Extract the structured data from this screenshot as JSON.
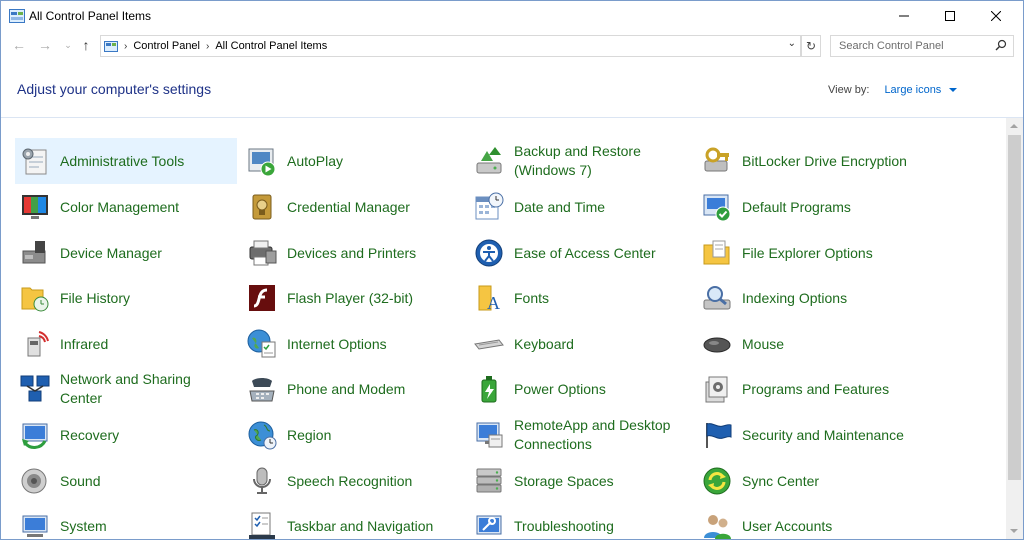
{
  "window": {
    "title": "All Control Panel Items",
    "minimize_icon": "minimize-icon",
    "maximize_icon": "maximize-icon",
    "close_icon": "close-icon"
  },
  "address": {
    "crumbs": [
      "Control Panel",
      "All Control Panel Items"
    ],
    "search_placeholder": "Search Control Panel"
  },
  "header": {
    "heading": "Adjust your computer's settings",
    "view_by_label": "View by:",
    "view_by_value": "Large icons"
  },
  "items": [
    {
      "label": "Administrative Tools",
      "icon": "administrative-tools-icon"
    },
    {
      "label": "AutoPlay",
      "icon": "autoplay-icon"
    },
    {
      "label": "Backup and Restore (Windows 7)",
      "icon": "backup-restore-icon"
    },
    {
      "label": "BitLocker Drive Encryption",
      "icon": "bitlocker-icon"
    },
    {
      "label": "Color Management",
      "icon": "color-management-icon"
    },
    {
      "label": "Credential Manager",
      "icon": "credential-manager-icon"
    },
    {
      "label": "Date and Time",
      "icon": "date-time-icon"
    },
    {
      "label": "Default Programs",
      "icon": "default-programs-icon"
    },
    {
      "label": "Device Manager",
      "icon": "device-manager-icon"
    },
    {
      "label": "Devices and Printers",
      "icon": "devices-printers-icon"
    },
    {
      "label": "Ease of Access Center",
      "icon": "ease-of-access-icon"
    },
    {
      "label": "File Explorer Options",
      "icon": "file-explorer-options-icon"
    },
    {
      "label": "File History",
      "icon": "file-history-icon"
    },
    {
      "label": "Flash Player (32-bit)",
      "icon": "flash-player-icon"
    },
    {
      "label": "Fonts",
      "icon": "fonts-icon"
    },
    {
      "label": "Indexing Options",
      "icon": "indexing-options-icon"
    },
    {
      "label": "Infrared",
      "icon": "infrared-icon"
    },
    {
      "label": "Internet Options",
      "icon": "internet-options-icon"
    },
    {
      "label": "Keyboard",
      "icon": "keyboard-icon"
    },
    {
      "label": "Mouse",
      "icon": "mouse-icon"
    },
    {
      "label": "Network and Sharing Center",
      "icon": "network-sharing-icon"
    },
    {
      "label": "Phone and Modem",
      "icon": "phone-modem-icon"
    },
    {
      "label": "Power Options",
      "icon": "power-options-icon"
    },
    {
      "label": "Programs and Features",
      "icon": "programs-features-icon"
    },
    {
      "label": "Recovery",
      "icon": "recovery-icon"
    },
    {
      "label": "Region",
      "icon": "region-icon"
    },
    {
      "label": "RemoteApp and Desktop Connections",
      "icon": "remoteapp-icon"
    },
    {
      "label": "Security and Maintenance",
      "icon": "security-maintenance-icon"
    },
    {
      "label": "Sound",
      "icon": "sound-icon"
    },
    {
      "label": "Speech Recognition",
      "icon": "speech-recognition-icon"
    },
    {
      "label": "Storage Spaces",
      "icon": "storage-spaces-icon"
    },
    {
      "label": "Sync Center",
      "icon": "sync-center-icon"
    },
    {
      "label": "System",
      "icon": "system-icon"
    },
    {
      "label": "Taskbar and Navigation",
      "icon": "taskbar-navigation-icon"
    },
    {
      "label": "Troubleshooting",
      "icon": "troubleshooting-icon"
    },
    {
      "label": "User Accounts",
      "icon": "user-accounts-icon"
    }
  ],
  "colors": {
    "link_green": "#1e6c1e",
    "heading_blue": "#1e3287",
    "hover_bg": "#e5f3ff",
    "accent": "#0066cc"
  }
}
